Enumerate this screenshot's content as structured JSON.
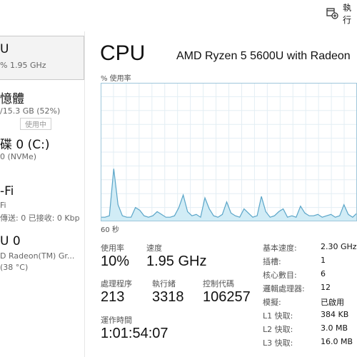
{
  "toolbar": {
    "run_task_label": "執行",
    "run_task_icon": "run-new-task-icon"
  },
  "sidebar": {
    "items": [
      {
        "title": "U",
        "sub": "% 1.95 GHz",
        "selected": true
      },
      {
        "title": "憶體",
        "sub": "/15.3 GB (52%)",
        "badge": "使用中"
      },
      {
        "title": "碟 0 (C:)",
        "sub": "0 (NVMe)"
      },
      {
        "title": "-Fi",
        "sub": "Fi",
        "sub2": "傳送: 0 已接收: 0 Kbp"
      },
      {
        "title": "U 0",
        "sub": "D Radeon(TM) Gr...",
        "sub2": "(38 °C)"
      }
    ]
  },
  "header": {
    "title": "CPU",
    "model": "AMD Ryzen 5 5600U with Radeon"
  },
  "graph": {
    "y_label": "% 使用率",
    "x_label": "60 秒",
    "line_color": "#5aa5c8",
    "fill_color": "#d1ecf6",
    "grid_color": "#e3eef4",
    "border_color": "#9fc7db"
  },
  "chart_data": {
    "type": "area",
    "x_label": "60 秒",
    "y_label": "% 使用率",
    "ylim": [
      0,
      100
    ],
    "values": [
      3,
      3,
      4,
      38,
      12,
      4,
      3,
      3,
      10,
      8,
      4,
      3,
      4,
      7,
      5,
      3,
      3,
      4,
      10,
      19,
      7,
      4,
      5,
      3,
      17,
      9,
      4,
      3,
      5,
      14,
      6,
      4,
      3,
      9,
      6,
      3,
      4,
      18,
      7,
      3,
      4,
      7,
      9,
      3,
      4,
      3,
      11,
      6,
      4,
      4,
      5,
      3,
      4,
      5,
      3,
      4,
      12,
      5,
      3,
      6
    ]
  },
  "stats": {
    "utilization": {
      "label": "使用率",
      "value": "10%"
    },
    "speed": {
      "label": "速度",
      "value": "1.95 GHz"
    },
    "processes": {
      "label": "處理程序",
      "value": "213"
    },
    "threads": {
      "label": "執行緒",
      "value": "3318"
    },
    "handles": {
      "label": "控制代碼",
      "value": "106257"
    },
    "uptime": {
      "label": "運作時間",
      "value": "1:01:54:07"
    }
  },
  "specs": [
    {
      "label": "基本速度:",
      "value": "2.30 GHz"
    },
    {
      "label": "插槽:",
      "value": "1"
    },
    {
      "label": "核心數目:",
      "value": "6"
    },
    {
      "label": "邏輯處理器:",
      "value": "12"
    },
    {
      "label": "模擬:",
      "value": "已啟用"
    },
    {
      "label": "L1 快取:",
      "value": "384 KB"
    },
    {
      "label": "L2 快取:",
      "value": "3.0 MB"
    },
    {
      "label": "L3 快取:",
      "value": "16.0 MB"
    }
  ]
}
